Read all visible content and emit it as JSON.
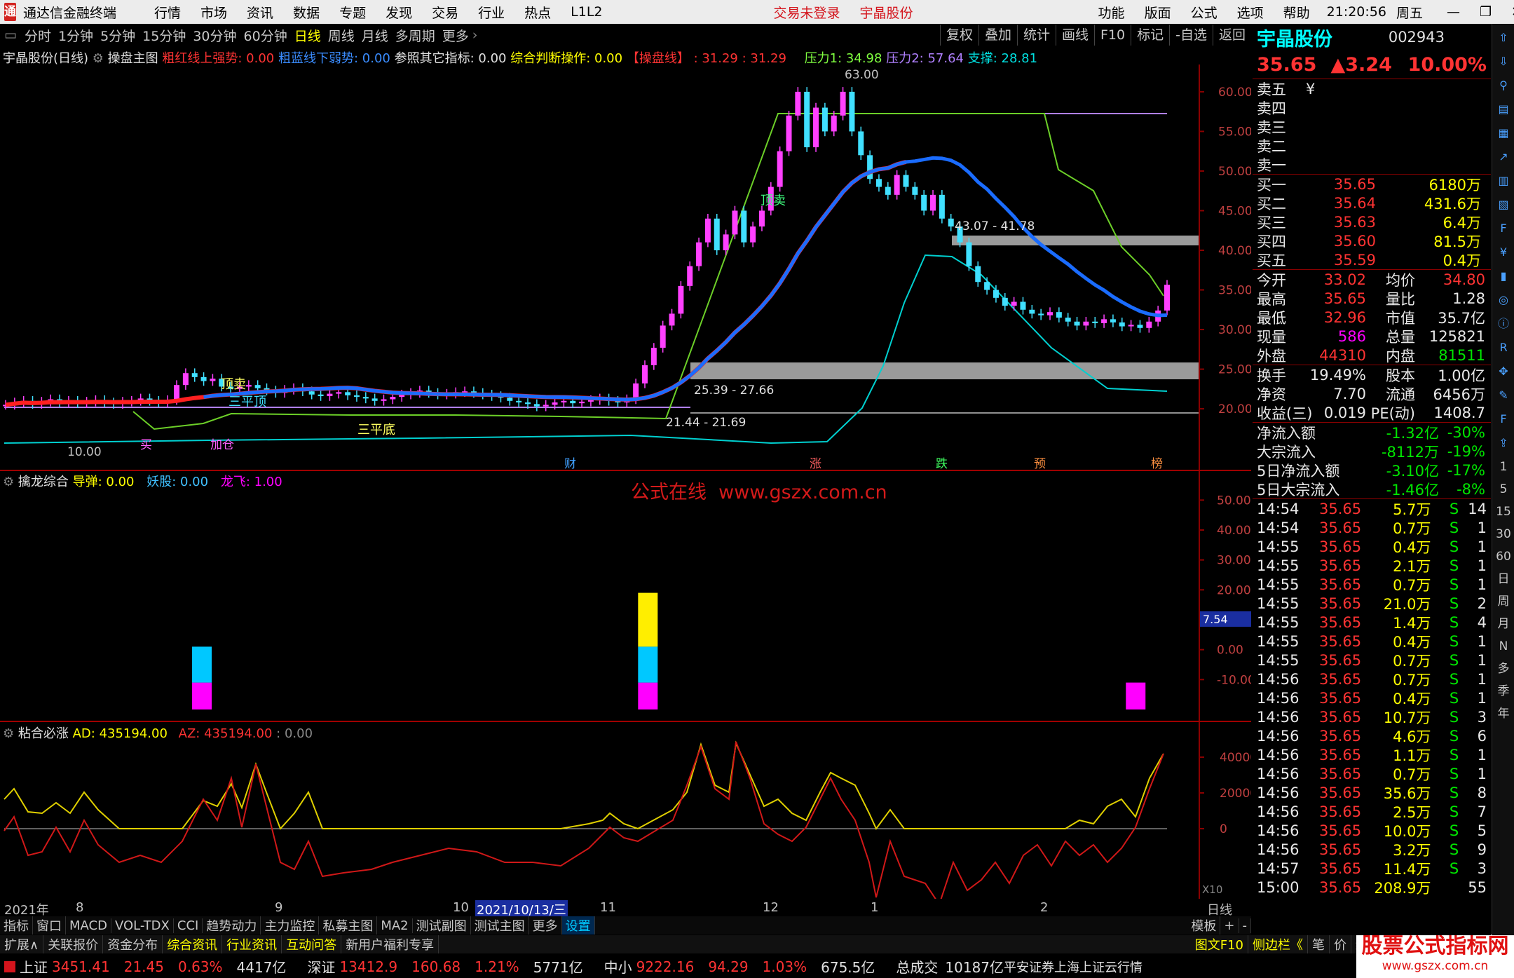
{
  "menubar": {
    "app_title": "通达信金融终端",
    "items": [
      "行情",
      "市场",
      "资讯",
      "数据",
      "专题",
      "发现",
      "交易",
      "行业",
      "热点",
      "L1L2"
    ],
    "login": "交易未登录",
    "stock": "宇晶股份",
    "right_items": [
      "功能",
      "版面",
      "公式",
      "选项",
      "帮助"
    ],
    "time": "21:20:56",
    "weekday": "周五"
  },
  "periods": [
    "分时",
    "1分钟",
    "5分钟",
    "15分钟",
    "30分钟",
    "60分钟",
    "日线",
    "周线",
    "月线",
    "多周期",
    "更多"
  ],
  "active_period": "日线",
  "toolbar_right": [
    "复权",
    "叠加",
    "统计",
    "画线",
    "F10",
    "标记",
    "-自选",
    "返回"
  ],
  "main_legend": {
    "title": "宇晶股份(日线)",
    "indicator": "操盘主图",
    "red_label": "粗红线上强势: 0.00",
    "blue_label": "粗蓝线下弱势: 0.00",
    "ref_label": "参照其它指标: 0.00",
    "judge_label": "综合判断操作: 0.00",
    "caopan_label": "【操盘线】",
    "v1": ": 31.29",
    "v2": ": 31.29",
    "press1": "压力1: 34.98",
    "press2": "压力2: 57.64",
    "support": "支撑: 28.81"
  },
  "annotations": {
    "high": "63.00",
    "low": "10.00",
    "zone1": "43.07 - 41.78",
    "zone2": "25.39 - 27.66",
    "zone3": "21.44 - 21.69",
    "ding": "顶卖",
    "sanpingding": "三平顶",
    "sanpingdi": "三平底",
    "jiacang": "加仓",
    "maiwu": "买",
    "markers": [
      "财",
      "涨",
      "跌",
      "预",
      "榜"
    ]
  },
  "main_yaxis": [
    "60.00",
    "55.00",
    "50.00",
    "45.00",
    "40.00",
    "35.00",
    "30.00",
    "25.00",
    "20.00"
  ],
  "sub1_legend": {
    "title": "擒龙综合",
    "a": "导弹: 0.00",
    "b": "妖股: 0.00",
    "c": "龙飞: 1.00"
  },
  "sub1_yaxis": [
    "50.00",
    "40.00",
    "30.00",
    "20.00",
    "0.00",
    "-10.00"
  ],
  "sub1_marker": "7.54",
  "watermark": "公式在线  www.gszx.com.cn",
  "sub2_legend": {
    "title": "粘合必涨",
    "ad": "AD: 435194.00",
    "az": "AZ: 435194.00",
    "z": ": 0.00"
  },
  "sub2_yaxis": [
    "40000",
    "20000",
    "0"
  ],
  "x10": "X10",
  "xaxis": [
    "2021年",
    "8",
    "9",
    "10",
    "11",
    "12",
    "1",
    "2"
  ],
  "xaxis_date": "2021/10/13/三",
  "xaxis_right": "日线",
  "bottom_tabs": [
    "指标",
    "窗口",
    "MACD",
    "VOL-TDX",
    "CCI",
    "趋势动力",
    "主力监控",
    "私募主图",
    "MA2",
    "测试副图",
    "测试主图",
    "更多",
    "设置"
  ],
  "bottom_tabs_right": [
    "模板",
    "+",
    "-"
  ],
  "ext_tabs": [
    "扩展∧",
    "关联报价",
    "资金分布",
    "综合资讯",
    "行业资讯",
    "互动问答",
    "新用户福利专享"
  ],
  "ext_right": [
    "图文F10",
    "侧边栏《",
    "笔",
    "价",
    "细",
    "势"
  ],
  "status": [
    {
      "name": "上证",
      "v": "3451.41",
      "c": "21.45",
      "p": "0.63%",
      "amt": "4417亿"
    },
    {
      "name": "深证",
      "v": "13412.9",
      "c": "160.68",
      "p": "1.21%",
      "amt": "5771亿"
    },
    {
      "name": "中小",
      "v": "9222.16",
      "c": "94.29",
      "p": "1.03%",
      "amt": "675.5亿"
    }
  ],
  "status_total": {
    "label": "总成交",
    "v": "10187亿",
    "src": "平安证券上海上证云行情"
  },
  "site_watermark": "股票公式指标网",
  "site_watermark_url": "www.gszx.com.cn",
  "quote": {
    "name": "宇晶股份",
    "code": "002943",
    "price": "35.65",
    "change": "▲3.24",
    "pct": "10.00%",
    "asks": [
      {
        "l": "卖五",
        "p": "¥",
        "v": ""
      },
      {
        "l": "卖四",
        "p": "",
        "v": ""
      },
      {
        "l": "卖三",
        "p": "",
        "v": ""
      },
      {
        "l": "卖二",
        "p": "",
        "v": ""
      },
      {
        "l": "卖一",
        "p": "",
        "v": ""
      }
    ],
    "bids": [
      {
        "l": "买一",
        "p": "35.65",
        "v": "6180万"
      },
      {
        "l": "买二",
        "p": "35.64",
        "v": "431.6万"
      },
      {
        "l": "买三",
        "p": "35.63",
        "v": "6.4万"
      },
      {
        "l": "买四",
        "p": "35.60",
        "v": "81.5万"
      },
      {
        "l": "买五",
        "p": "35.59",
        "v": "0.4万"
      }
    ],
    "stats": [
      {
        "a": "今开",
        "av": "33.02",
        "b": "均价",
        "bv": "34.80"
      },
      {
        "a": "最高",
        "av": "35.65",
        "b": "量比",
        "bv": "1.28"
      },
      {
        "a": "最低",
        "av": "32.96",
        "b": "市值",
        "bv": "35.7亿"
      },
      {
        "a": "现量",
        "av": "586",
        "b": "总量",
        "bv": "125821"
      },
      {
        "a": "外盘",
        "av": "44310",
        "b": "内盘",
        "bv": "81511"
      }
    ],
    "stats2": [
      {
        "a": "换手",
        "av": "19.49%",
        "b": "股本",
        "bv": "1.00亿"
      },
      {
        "a": "净资",
        "av": "7.70",
        "b": "流通",
        "bv": "6456万"
      },
      {
        "a": "收益(三)",
        "av": "0.019",
        "b": "PE(动)",
        "bv": "1408.7"
      }
    ],
    "flows": [
      {
        "l": "净流入额",
        "v": "-1.32亿",
        "p": "-30%"
      },
      {
        "l": "大宗流入",
        "v": "-8112万",
        "p": "-19%"
      },
      {
        "l": "5日净流入额",
        "v": "-3.10亿",
        "p": "-17%"
      },
      {
        "l": "5日大宗流入",
        "v": "-1.46亿",
        "p": "-8%"
      }
    ],
    "ticks": [
      {
        "t": "14:54",
        "p": "35.65",
        "v": "5.7万",
        "s": "S",
        "n": "14"
      },
      {
        "t": "14:54",
        "p": "35.65",
        "v": "0.7万",
        "s": "S",
        "n": "1"
      },
      {
        "t": "14:55",
        "p": "35.65",
        "v": "0.4万",
        "s": "S",
        "n": "1"
      },
      {
        "t": "14:55",
        "p": "35.65",
        "v": "2.1万",
        "s": "S",
        "n": "1"
      },
      {
        "t": "14:55",
        "p": "35.65",
        "v": "0.7万",
        "s": "S",
        "n": "1"
      },
      {
        "t": "14:55",
        "p": "35.65",
        "v": "21.0万",
        "s": "S",
        "n": "2"
      },
      {
        "t": "14:55",
        "p": "35.65",
        "v": "1.4万",
        "s": "S",
        "n": "4"
      },
      {
        "t": "14:55",
        "p": "35.65",
        "v": "0.4万",
        "s": "S",
        "n": "1"
      },
      {
        "t": "14:55",
        "p": "35.65",
        "v": "0.7万",
        "s": "S",
        "n": "1"
      },
      {
        "t": "14:56",
        "p": "35.65",
        "v": "0.7万",
        "s": "S",
        "n": "1"
      },
      {
        "t": "14:56",
        "p": "35.65",
        "v": "0.4万",
        "s": "S",
        "n": "1"
      },
      {
        "t": "14:56",
        "p": "35.65",
        "v": "10.7万",
        "s": "S",
        "n": "3"
      },
      {
        "t": "14:56",
        "p": "35.65",
        "v": "4.6万",
        "s": "S",
        "n": "6"
      },
      {
        "t": "14:56",
        "p": "35.65",
        "v": "1.1万",
        "s": "S",
        "n": "1"
      },
      {
        "t": "14:56",
        "p": "35.65",
        "v": "0.7万",
        "s": "S",
        "n": "1"
      },
      {
        "t": "14:56",
        "p": "35.65",
        "v": "35.6万",
        "s": "S",
        "n": "8"
      },
      {
        "t": "14:56",
        "p": "35.65",
        "v": "2.5万",
        "s": "S",
        "n": "7"
      },
      {
        "t": "14:56",
        "p": "35.65",
        "v": "10.0万",
        "s": "S",
        "n": "5"
      },
      {
        "t": "14:56",
        "p": "35.65",
        "v": "3.2万",
        "s": "S",
        "n": "9"
      },
      {
        "t": "14:57",
        "p": "35.65",
        "v": "11.4万",
        "s": "S",
        "n": "3"
      },
      {
        "t": "15:00",
        "p": "35.65",
        "v": "208.9万",
        "s": "",
        "n": "55"
      }
    ]
  },
  "sidebar_labels": [
    "1",
    "5",
    "15",
    "30",
    "60",
    "日",
    "周",
    "月",
    "N",
    "多",
    "季",
    "年"
  ],
  "chart_data": {
    "type": "candlestick",
    "price_range": [
      17,
      63
    ],
    "close_path": [
      20.5,
      20.8,
      21.0,
      20.6,
      20.9,
      21.2,
      20.8,
      21.0,
      20.7,
      20.9,
      21.1,
      20.8,
      20.6,
      20.9,
      21.0,
      21.3,
      21.0,
      20.8,
      21.1,
      23.0,
      24.5,
      24.0,
      23.5,
      23.8,
      22.8,
      22.5,
      22.8,
      23.0,
      22.6,
      22.3,
      22.0,
      22.4,
      22.6,
      22.2,
      21.8,
      21.6,
      21.9,
      22.1,
      21.7,
      21.5,
      21.3,
      21.0,
      21.2,
      21.5,
      21.8,
      22.0,
      22.3,
      22.0,
      21.8,
      21.9,
      22.1,
      22.2,
      22.0,
      21.8,
      21.6,
      21.4,
      21.0,
      20.8,
      20.6,
      20.3,
      20.5,
      20.8,
      21.0,
      20.7,
      20.9,
      21.1,
      21.3,
      21.0,
      20.8,
      21.2,
      23.2,
      25.5,
      27.7,
      30.5,
      32.0,
      35.5,
      38.0,
      41.0,
      44.0,
      40.0,
      42.0,
      45.0,
      41.0,
      43.0,
      45.0,
      48.0,
      52.5,
      57.0,
      60.0,
      53.0,
      58.0,
      55.0,
      57.0,
      60.0,
      55.0,
      52.0,
      49.0,
      48.0,
      47.0,
      49.5,
      48.0,
      47.0,
      45.0,
      47.0,
      44.0,
      43.0,
      41.0,
      38.0,
      36.0,
      35.0,
      34.0,
      33.0,
      33.5,
      32.5,
      32.0,
      31.8,
      32.2,
      31.5,
      31.0,
      30.5,
      31.0,
      30.8,
      31.3,
      30.9,
      30.4,
      30.6,
      30.2,
      31.0,
      32.4,
      35.65
    ],
    "ma_blue": [
      21.2,
      21.3,
      21.5,
      21.8,
      22.0,
      22.2,
      21.9,
      21.6,
      21.4,
      21.5,
      21.7,
      21.8,
      21.6,
      21.3,
      21.0,
      20.9,
      20.7,
      20.8,
      21.0,
      21.1
    ],
    "bars_sub1": [
      {
        "pos": 0.169,
        "magenta": 9,
        "cyan": 12,
        "yellow": 0
      },
      {
        "pos": 0.553,
        "magenta": 9,
        "cyan": 12,
        "yellow": 18
      },
      {
        "pos": 0.973,
        "magenta": 9,
        "cyan": 0,
        "yellow": 0
      }
    ],
    "sub1_range": [
      -20,
      55
    ]
  }
}
